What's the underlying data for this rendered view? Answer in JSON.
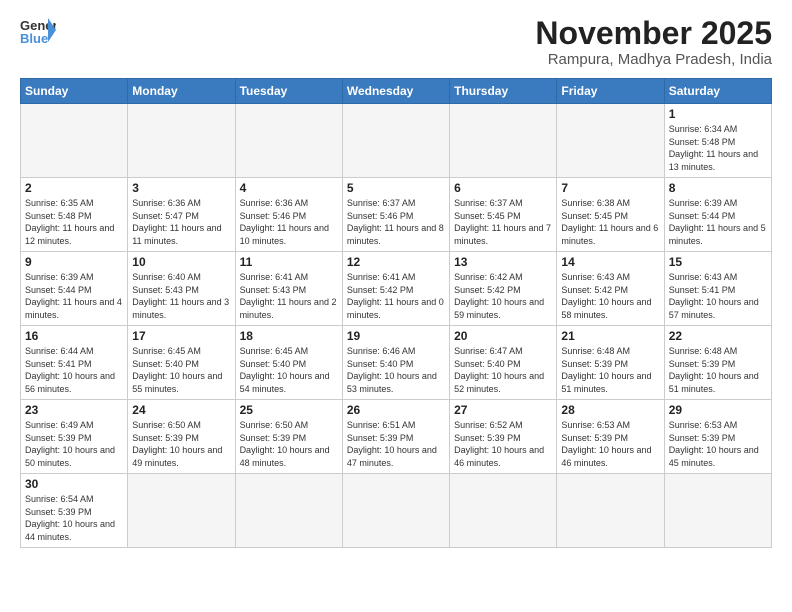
{
  "header": {
    "logo_general": "General",
    "logo_blue": "Blue",
    "month_title": "November 2025",
    "location": "Rampura, Madhya Pradesh, India"
  },
  "days_of_week": [
    "Sunday",
    "Monday",
    "Tuesday",
    "Wednesday",
    "Thursday",
    "Friday",
    "Saturday"
  ],
  "weeks": [
    [
      {
        "day": "",
        "info": ""
      },
      {
        "day": "",
        "info": ""
      },
      {
        "day": "",
        "info": ""
      },
      {
        "day": "",
        "info": ""
      },
      {
        "day": "",
        "info": ""
      },
      {
        "day": "",
        "info": ""
      },
      {
        "day": "1",
        "info": "Sunrise: 6:34 AM\nSunset: 5:48 PM\nDaylight: 11 hours and 13 minutes."
      }
    ],
    [
      {
        "day": "2",
        "info": "Sunrise: 6:35 AM\nSunset: 5:48 PM\nDaylight: 11 hours and 12 minutes."
      },
      {
        "day": "3",
        "info": "Sunrise: 6:36 AM\nSunset: 5:47 PM\nDaylight: 11 hours and 11 minutes."
      },
      {
        "day": "4",
        "info": "Sunrise: 6:36 AM\nSunset: 5:46 PM\nDaylight: 11 hours and 10 minutes."
      },
      {
        "day": "5",
        "info": "Sunrise: 6:37 AM\nSunset: 5:46 PM\nDaylight: 11 hours and 8 minutes."
      },
      {
        "day": "6",
        "info": "Sunrise: 6:37 AM\nSunset: 5:45 PM\nDaylight: 11 hours and 7 minutes."
      },
      {
        "day": "7",
        "info": "Sunrise: 6:38 AM\nSunset: 5:45 PM\nDaylight: 11 hours and 6 minutes."
      },
      {
        "day": "8",
        "info": "Sunrise: 6:39 AM\nSunset: 5:44 PM\nDaylight: 11 hours and 5 minutes."
      }
    ],
    [
      {
        "day": "9",
        "info": "Sunrise: 6:39 AM\nSunset: 5:44 PM\nDaylight: 11 hours and 4 minutes."
      },
      {
        "day": "10",
        "info": "Sunrise: 6:40 AM\nSunset: 5:43 PM\nDaylight: 11 hours and 3 minutes."
      },
      {
        "day": "11",
        "info": "Sunrise: 6:41 AM\nSunset: 5:43 PM\nDaylight: 11 hours and 2 minutes."
      },
      {
        "day": "12",
        "info": "Sunrise: 6:41 AM\nSunset: 5:42 PM\nDaylight: 11 hours and 0 minutes."
      },
      {
        "day": "13",
        "info": "Sunrise: 6:42 AM\nSunset: 5:42 PM\nDaylight: 10 hours and 59 minutes."
      },
      {
        "day": "14",
        "info": "Sunrise: 6:43 AM\nSunset: 5:42 PM\nDaylight: 10 hours and 58 minutes."
      },
      {
        "day": "15",
        "info": "Sunrise: 6:43 AM\nSunset: 5:41 PM\nDaylight: 10 hours and 57 minutes."
      }
    ],
    [
      {
        "day": "16",
        "info": "Sunrise: 6:44 AM\nSunset: 5:41 PM\nDaylight: 10 hours and 56 minutes."
      },
      {
        "day": "17",
        "info": "Sunrise: 6:45 AM\nSunset: 5:40 PM\nDaylight: 10 hours and 55 minutes."
      },
      {
        "day": "18",
        "info": "Sunrise: 6:45 AM\nSunset: 5:40 PM\nDaylight: 10 hours and 54 minutes."
      },
      {
        "day": "19",
        "info": "Sunrise: 6:46 AM\nSunset: 5:40 PM\nDaylight: 10 hours and 53 minutes."
      },
      {
        "day": "20",
        "info": "Sunrise: 6:47 AM\nSunset: 5:40 PM\nDaylight: 10 hours and 52 minutes."
      },
      {
        "day": "21",
        "info": "Sunrise: 6:48 AM\nSunset: 5:39 PM\nDaylight: 10 hours and 51 minutes."
      },
      {
        "day": "22",
        "info": "Sunrise: 6:48 AM\nSunset: 5:39 PM\nDaylight: 10 hours and 51 minutes."
      }
    ],
    [
      {
        "day": "23",
        "info": "Sunrise: 6:49 AM\nSunset: 5:39 PM\nDaylight: 10 hours and 50 minutes."
      },
      {
        "day": "24",
        "info": "Sunrise: 6:50 AM\nSunset: 5:39 PM\nDaylight: 10 hours and 49 minutes."
      },
      {
        "day": "25",
        "info": "Sunrise: 6:50 AM\nSunset: 5:39 PM\nDaylight: 10 hours and 48 minutes."
      },
      {
        "day": "26",
        "info": "Sunrise: 6:51 AM\nSunset: 5:39 PM\nDaylight: 10 hours and 47 minutes."
      },
      {
        "day": "27",
        "info": "Sunrise: 6:52 AM\nSunset: 5:39 PM\nDaylight: 10 hours and 46 minutes."
      },
      {
        "day": "28",
        "info": "Sunrise: 6:53 AM\nSunset: 5:39 PM\nDaylight: 10 hours and 46 minutes."
      },
      {
        "day": "29",
        "info": "Sunrise: 6:53 AM\nSunset: 5:39 PM\nDaylight: 10 hours and 45 minutes."
      }
    ],
    [
      {
        "day": "30",
        "info": "Sunrise: 6:54 AM\nSunset: 5:39 PM\nDaylight: 10 hours and 44 minutes."
      },
      {
        "day": "",
        "info": ""
      },
      {
        "day": "",
        "info": ""
      },
      {
        "day": "",
        "info": ""
      },
      {
        "day": "",
        "info": ""
      },
      {
        "day": "",
        "info": ""
      },
      {
        "day": "",
        "info": ""
      }
    ]
  ]
}
